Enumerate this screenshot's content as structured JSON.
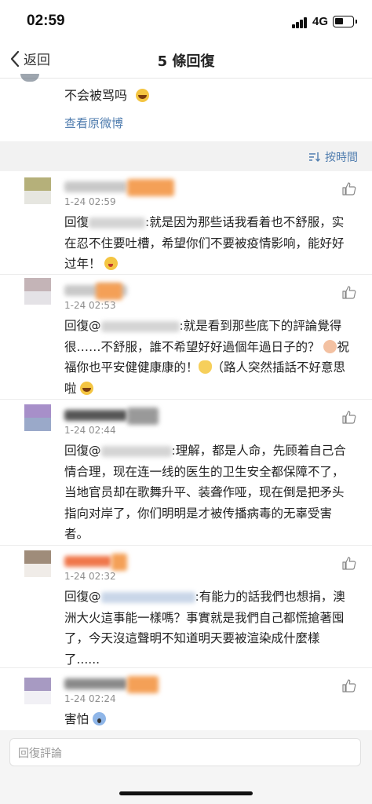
{
  "status_bar": {
    "time": "02:59",
    "network": "4G",
    "battery_level": 0.45
  },
  "nav": {
    "back_label": "返回",
    "title": "5 條回復"
  },
  "original_post": {
    "text": "不会被骂吗",
    "emoji": "laugh-emoji",
    "view_original_label": "查看原微博"
  },
  "sort": {
    "label": "按時間"
  },
  "comments": [
    {
      "time": "1-24 02:59",
      "reply_prefix": "回復",
      "text": ":就是因为那些话我看着也不舒服，实在忍不住要吐槽，希望你们不要被疫情影响，能好好过年！",
      "avatar_colors": [
        "#b5b07a",
        "#e6e6e0"
      ]
    },
    {
      "time": "1-24 02:53",
      "reply_prefix": "回復@",
      "text": ":就是看到那些底下的評論覺得很……不舒服，誰不希望好好過個年過日子的？",
      "text_2": "祝福你也平安健健康康的！",
      "text_3": "（路人突然插話不好意思啦",
      "avatar_colors": [
        "#c4b4b7",
        "#e4e2e6"
      ]
    },
    {
      "time": "1-24 02:44",
      "reply_prefix": "回復@",
      "text": ":理解，都是人命，先顾着自己合情合理，现在连一线的医生的卫生安全都保障不了，当地官员却在歌舞升平、装聋作哑，现在倒是把矛头指向对岸了，你们明明是才被传播病毒的无辜受害者。",
      "avatar_colors": [
        "#a78fc9",
        "#9aa9c9"
      ]
    },
    {
      "time": "1-24 02:32",
      "reply_prefix": "回復@",
      "text": ":有能力的話我們也想捐，澳洲大火這事能一樣嗎？事實就是我們自己都慌搶著囤了，今天沒這聲明不知道明天要被渲染成什麼樣了......",
      "avatar_colors": [
        "#9f8c7a",
        "#f0ece8"
      ]
    },
    {
      "time": "1-24 02:24",
      "text": "害怕",
      "avatar_colors": [
        "#a79ac2",
        "#f1f0f5"
      ]
    }
  ],
  "reply_input": {
    "placeholder": "回復評論"
  }
}
